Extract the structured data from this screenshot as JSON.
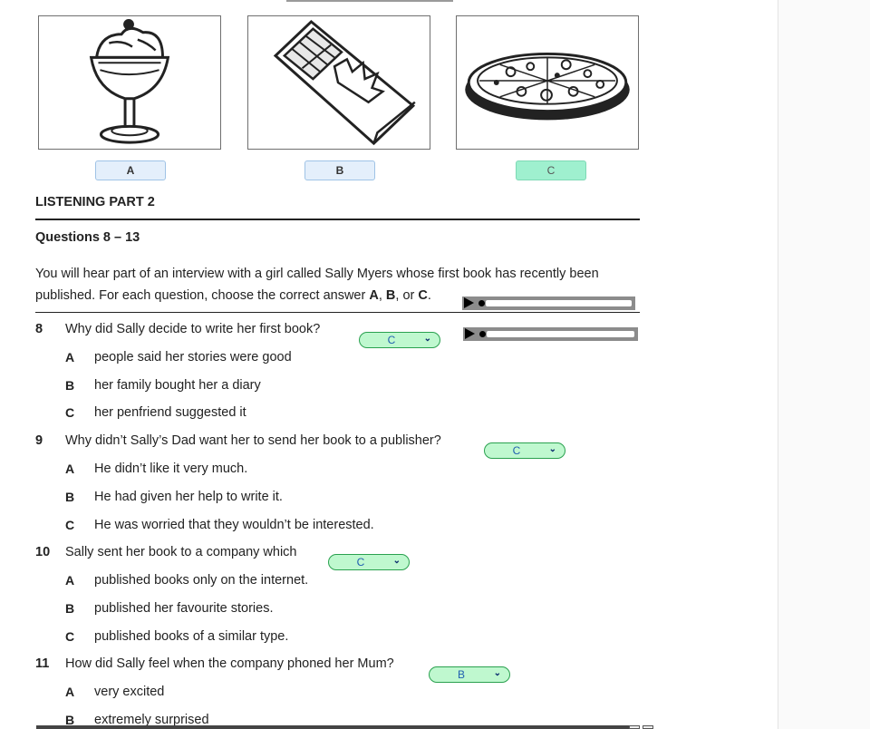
{
  "pictures": {
    "options": [
      {
        "label": "A",
        "selected": false
      },
      {
        "label": "B",
        "selected": false
      },
      {
        "label": "C",
        "selected": true
      }
    ]
  },
  "section": {
    "title": "LISTENING PART 2",
    "subtitle": "Questions 8 – 13",
    "instructions_prefix": "You will hear part of an interview with a girl called Sally Myers whose first book has recently been published. For each question, choose the correct answer ",
    "instr_a": "A",
    "instr_sep1": ", ",
    "instr_b": "B",
    "instr_sep2": ", or ",
    "instr_c": "C",
    "instr_end": "."
  },
  "questions": [
    {
      "number": "8",
      "text": "Why did Sally decide to write her first book?",
      "answer": "C",
      "options": [
        {
          "letter": "A",
          "text": "people said her stories were good"
        },
        {
          "letter": "B",
          "text": "her family bought her a diary"
        },
        {
          "letter": "C",
          "text": "her penfriend suggested it"
        }
      ]
    },
    {
      "number": "9",
      "text": "Why didn’t Sally’s Dad want her to send her book to a publisher?",
      "answer": "C",
      "options": [
        {
          "letter": "A",
          "text": "He didn’t like it very much."
        },
        {
          "letter": "B",
          "text": "He had given her help to write it."
        },
        {
          "letter": "C",
          "text": "He was worried that they wouldn’t be interested."
        }
      ]
    },
    {
      "number": "10",
      "text": "Sally sent her book to a company which",
      "answer": "C",
      "options": [
        {
          "letter": "A",
          "text": "published books only on the internet."
        },
        {
          "letter": "B",
          "text": "published her favourite stories."
        },
        {
          "letter": "C",
          "text": "published books of a similar type."
        }
      ]
    },
    {
      "number": "11",
      "text": "How did Sally feel when the company phoned her Mum?",
      "answer": "B",
      "options": [
        {
          "letter": "A",
          "text": "very excited"
        },
        {
          "letter": "B",
          "text": "extremely surprised"
        }
      ]
    }
  ],
  "icons": {
    "play": "play-icon",
    "dropdown": "chevron-down-icon"
  }
}
